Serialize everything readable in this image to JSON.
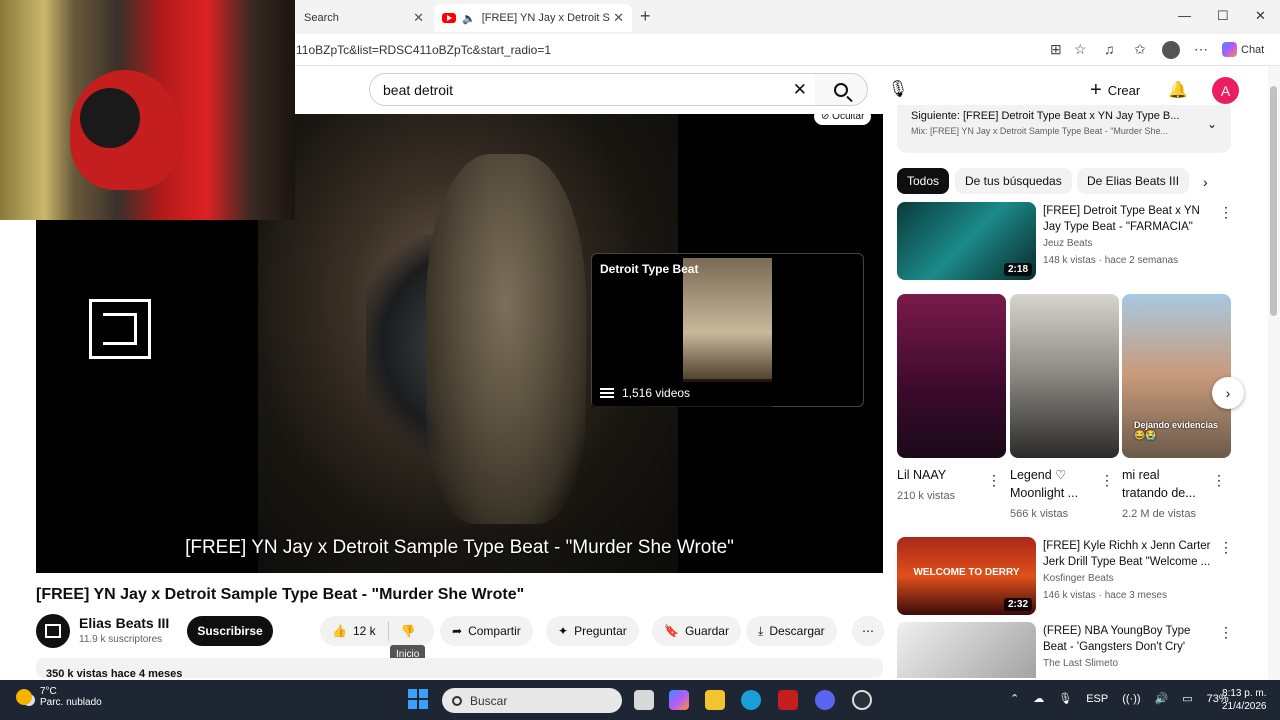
{
  "browser": {
    "tabs": [
      {
        "label": "Search"
      },
      {
        "label": "[FREE] YN Jay x Detroit Sampl"
      }
    ],
    "new_tab": "+",
    "url": "11oBZpTc&list=RDSC411oBZpTc&start_radio=1",
    "chat_label": "Chat"
  },
  "youtube": {
    "search_value": "beat detroit",
    "create_label": "Crear",
    "avatar_letter": "A"
  },
  "player": {
    "hide_label": "Ocultar",
    "card_title": "Detroit Type Beat",
    "card_count": "1,516 videos",
    "caption": "[FREE] YN Jay x Detroit Sample Type Beat - \"Murder She Wrote\""
  },
  "video": {
    "title": "[FREE] YN Jay x Detroit Sample Type Beat - \"Murder She Wrote\"",
    "channel": "Elias Beats III",
    "subscribers": "11.9 k suscriptores",
    "subscribe": "Suscribirse",
    "likes": "12 k",
    "tooltip": "Inicio",
    "share": "Compartir",
    "ask": "Preguntar",
    "save": "Guardar",
    "download": "Descargar",
    "description_peek": "350 k vistas  hace 4 meses"
  },
  "sidebar": {
    "upnext_title": "Siguiente: [FREE] Detroit Type Beat x YN Jay Type B...",
    "upnext_sub": "Mix: [FREE] YN Jay x Detroit Sample Type Beat - \"Murder She...",
    "chips": [
      "Todos",
      "De tus búsquedas",
      "De Elias Beats III"
    ],
    "videos": [
      {
        "title": "[FREE] Detroit Type Beat x YN Jay Type Beat - \"FARMACIA\"",
        "channel": "Jeuz Beats",
        "meta": "148 k vistas · hace 2 semanas",
        "duration": "2:18"
      },
      {
        "title": "[FREE] Kyle Richh x Jenn Carter Jerk Drill Type Beat \"Welcome ...",
        "channel": "Kosfinger Beats",
        "meta": "146 k vistas · hace 3 meses",
        "duration": "2:32",
        "thumb_text": "WELCOME TO DERRY"
      },
      {
        "title": "(FREE) NBA YoungBoy Type Beat - 'Gangsters Don't Cry'",
        "channel": "The Last Slimeto",
        "meta": "",
        "duration": ""
      }
    ],
    "shorts": [
      {
        "title": "Lil NAAY",
        "views": "210 k vistas"
      },
      {
        "title": "Legend ♡ Moonlight ...",
        "views": "566 k vistas"
      },
      {
        "title": "mi real tratando de...",
        "views": "2.2 M de vistas",
        "overlay": "Dejando evidencias 😂😭"
      }
    ]
  },
  "taskbar": {
    "temp": "7°C",
    "weather": "Parc. nublado",
    "search": "Buscar",
    "lang": "ESP",
    "battery": "73%",
    "time": "8:13 p. m.",
    "date": "21/4/2026"
  },
  "colors": {
    "accent": "#ff0000",
    "avatar": "#e91e63",
    "taskbar": "#1f2633"
  }
}
